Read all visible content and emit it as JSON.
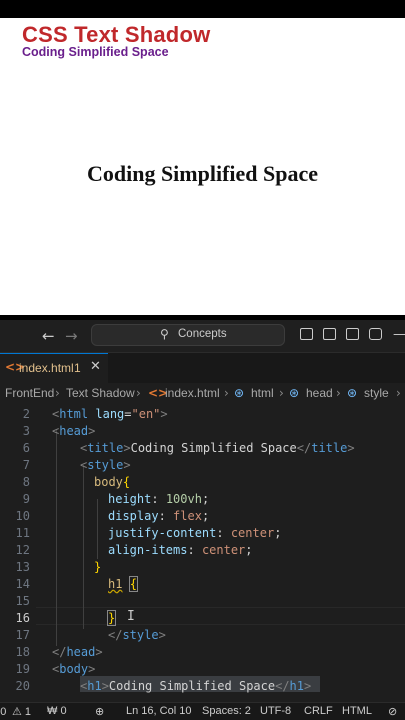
{
  "overlay": {
    "title": "CSS Text Shadow",
    "subtitle": "Coding Simplified Space"
  },
  "preview": {
    "heading": "Coding Simplified Space"
  },
  "titlebar": {
    "back_icon": "arrow-left-icon",
    "forward_icon": "arrow-right-icon",
    "search_text": "Concepts"
  },
  "tab": {
    "filename": "index.html",
    "problems": "1",
    "close": "✕"
  },
  "breadcrumb": {
    "items": [
      "FrontEnd",
      "Text Shadow",
      "index.html",
      "html",
      "head",
      "style"
    ]
  },
  "editor": {
    "line_numbers": [
      "2",
      "3",
      "6",
      "7",
      "8",
      "9",
      "10",
      "11",
      "12",
      "13",
      "14",
      "15",
      "16",
      "17",
      "18",
      "19",
      "20"
    ],
    "active_line": "16",
    "lines": {
      "l2": {
        "open": "<",
        "tag": "html",
        "attr": " lang",
        "eq": "=",
        "str": "\"en\"",
        "close": ">"
      },
      "l3": {
        "open": "<",
        "tag": "head",
        "close": ">"
      },
      "l6": {
        "open": "<",
        "tag": "title",
        "close": ">",
        "text": "Coding Simplified Space",
        "endopen": "</",
        "endtag": "title",
        "endclose": ">"
      },
      "l7": {
        "open": "<",
        "tag": "style",
        "close": ">"
      },
      "l8": {
        "sel": "body",
        "brace": "{"
      },
      "l9": {
        "prop": "height",
        "colon": ": ",
        "val": "100vh",
        "semi": ";"
      },
      "l10": {
        "prop": "display",
        "colon": ": ",
        "val": "flex",
        "semi": ";"
      },
      "l11": {
        "prop": "justify-content",
        "colon": ": ",
        "val": "center",
        "semi": ";"
      },
      "l12": {
        "prop": "align-items",
        "colon": ": ",
        "val": "center",
        "semi": ";"
      },
      "l13": {
        "brace": "}"
      },
      "l14": {
        "sel": "h1",
        "brace": "{"
      },
      "l16": {
        "brace": "}"
      },
      "l17": {
        "open": "</",
        "tag": "style",
        "close": ">"
      },
      "l18": {
        "open": "</",
        "tag": "head",
        "close": ">"
      },
      "l19": {
        "open": "<",
        "tag": "body",
        "close": ">"
      },
      "l20": {
        "open": "<",
        "tag": "h1",
        "close": ">",
        "text": "Coding Simplified Space",
        "endopen": "</",
        "endtag": "h1",
        "endclose": ">"
      }
    }
  },
  "statusbar": {
    "errors": "⊗ 0",
    "warnings": "⚠ 1",
    "ports": "₩ 0",
    "position": "Ln 16, Col 10",
    "spaces": "Spaces: 2",
    "encoding": "UTF-8",
    "eol": "CRLF",
    "language": "HTML"
  },
  "colors": {
    "accent": "#0078d4",
    "brand_red": "#c0282b",
    "brand_purple": "#6a1f8c"
  }
}
